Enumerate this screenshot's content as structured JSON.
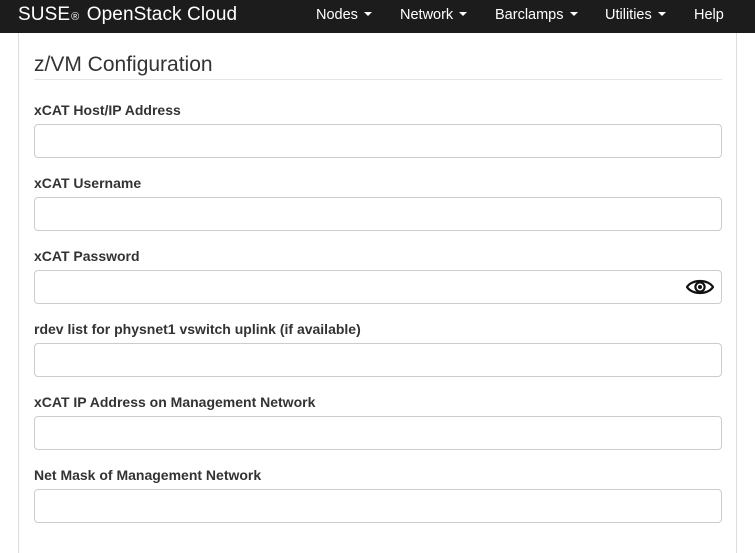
{
  "navbar": {
    "brand": "SUSE",
    "brand_reg": "®",
    "brand_product": "OpenStack Cloud",
    "items": [
      {
        "label": "Nodes",
        "dropdown": true
      },
      {
        "label": "Network",
        "dropdown": true
      },
      {
        "label": "Barclamps",
        "dropdown": true
      },
      {
        "label": "Utilities",
        "dropdown": true
      },
      {
        "label": "Help",
        "dropdown": false
      }
    ]
  },
  "section": {
    "title": "z/VM Configuration"
  },
  "fields": [
    {
      "label": "xCAT Host/IP Address",
      "value": "",
      "type": "text"
    },
    {
      "label": "xCAT Username",
      "value": "",
      "type": "text"
    },
    {
      "label": "xCAT Password",
      "value": "",
      "type": "password",
      "toggle_icon": "eye-icon"
    },
    {
      "label": "rdev list for physnet1 vswitch uplink (if available)",
      "value": "",
      "type": "text"
    },
    {
      "label": "xCAT IP Address on Management Network",
      "value": "",
      "type": "text"
    },
    {
      "label": "Net Mask of Management Network",
      "value": "",
      "type": "text"
    }
  ],
  "colors": {
    "navbar_bg": "#1c1c1c",
    "text": "#333333",
    "input_border": "#cccccc"
  }
}
